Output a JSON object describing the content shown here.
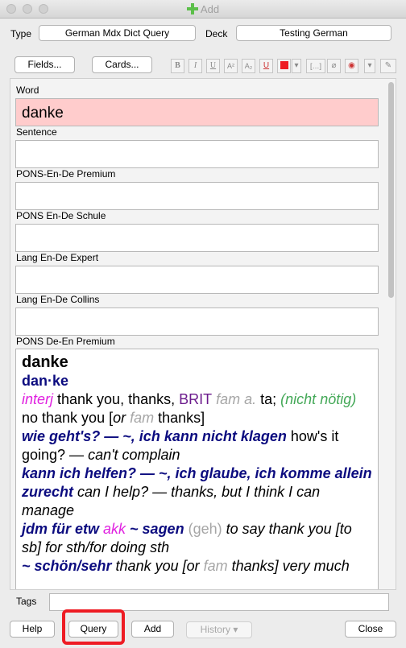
{
  "window": {
    "title": "Add"
  },
  "type_row": {
    "type_label": "Type",
    "type_value": "German Mdx Dict Query",
    "deck_label": "Deck",
    "deck_value": "Testing German"
  },
  "toolbar": {
    "fields_button": "Fields...",
    "cards_button": "Cards...",
    "format_buttons": [
      {
        "icon": "bold-icon",
        "glyph": "B"
      },
      {
        "icon": "italic-icon",
        "glyph": "I"
      },
      {
        "icon": "underline-icon",
        "glyph": "U"
      },
      {
        "icon": "superscript-icon",
        "glyph": "A²"
      },
      {
        "icon": "subscript-icon",
        "glyph": "A₂"
      },
      {
        "icon": "clear-format-icon",
        "glyph": "U"
      },
      {
        "icon": "text-color-icon",
        "glyph": ""
      },
      {
        "icon": "color-dropdown-icon",
        "glyph": "▾"
      },
      {
        "icon": "cloze-icon",
        "glyph": "[…]"
      },
      {
        "icon": "attach-icon",
        "glyph": "⌀"
      },
      {
        "icon": "record-icon",
        "glyph": "◉"
      },
      {
        "icon": "more-dropdown-icon",
        "glyph": "▾"
      },
      {
        "icon": "extra-icon",
        "glyph": "✎"
      }
    ],
    "text_color": "#ee1c24"
  },
  "fields": {
    "word": {
      "label": "Word",
      "value": "danke"
    },
    "sentence": {
      "label": "Sentence",
      "value": ""
    },
    "pons_en_de_premium": {
      "label": "PONS-En-De Premium",
      "value": ""
    },
    "pons_en_de_schule": {
      "label": "PONS En-De Schule",
      "value": ""
    },
    "lang_en_de_expert": {
      "label": "Lang En-De Expert",
      "value": ""
    },
    "lang_en_de_collins": {
      "label": "Lang En-De Collins",
      "value": ""
    },
    "pons_de_en_premium": {
      "label": "PONS De-En Premium",
      "headword": "danke",
      "syllabified": "dan·ke",
      "pos": "interj",
      "sense_main": " thank you, thanks, ",
      "region": "BRIT",
      "register": " fam a.",
      "ta": " ta; ",
      "nicht_open": "(nicht nötig)",
      "nicht_rest": " no thank you [",
      "or1": "or",
      "fam1": " fam",
      "thanks1": " thanks]",
      "ex1_de": "wie geht's? — ~, ich kann nicht klagen",
      "ex1_en": " how's it going? — ",
      "ex1_en_it": "can't complain",
      "ex2_de": "kann ich helfen? — ~, ich glaube, ich komme allein zurecht",
      "ex2_en": " can I help? — thanks, but I think I can manage",
      "ex3_de1": "jdm für etw ",
      "ex3_akk": "akk",
      "ex3_de2": " ~ sagen",
      "ex3_geh": " (geh)",
      "ex3_en": " to say thank you [to sb] for sth/for doing sth",
      "ex4_de": "~ schön/sehr",
      "ex4_en1": " thank you [",
      "ex4_or": "or",
      "ex4_fam": " fam",
      "ex4_en2": " thanks] very much"
    }
  },
  "tags": {
    "label": "Tags",
    "value": ""
  },
  "bottom": {
    "help": "Help",
    "query": "Query",
    "add": "Add",
    "history": "History",
    "close": "Close"
  }
}
